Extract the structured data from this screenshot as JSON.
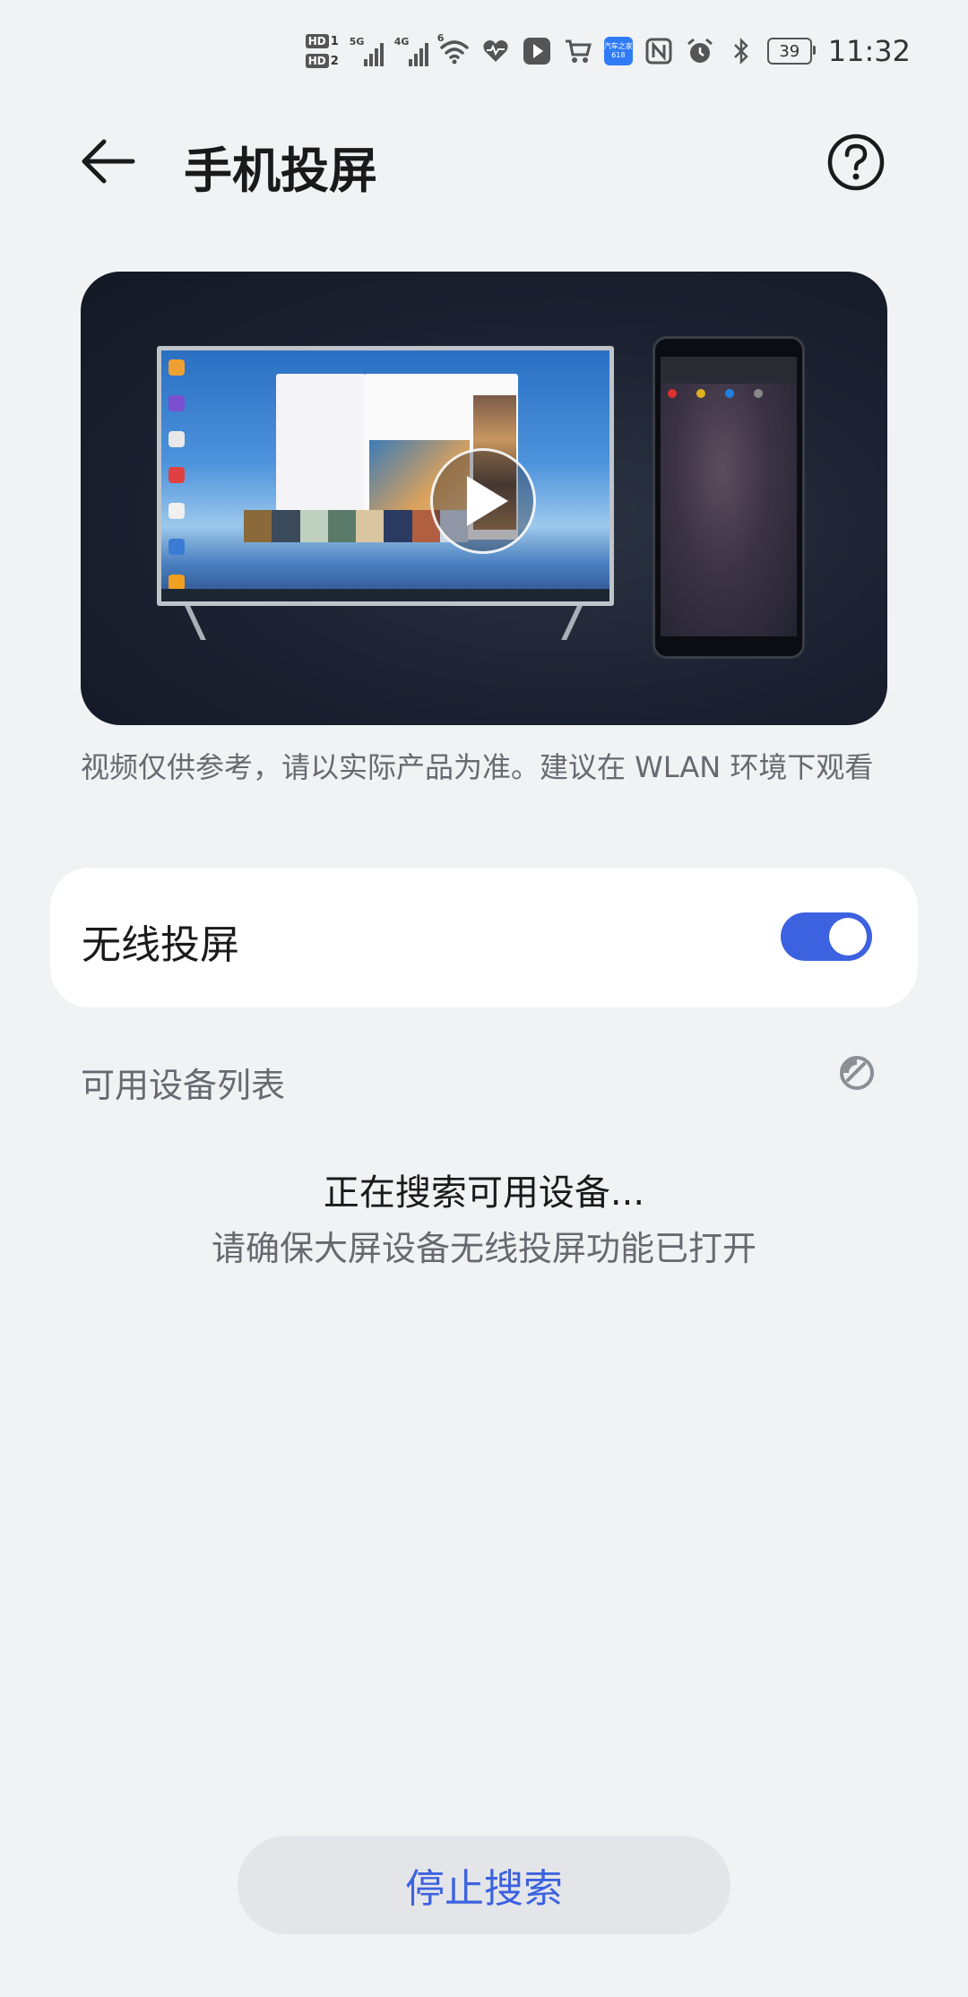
{
  "status_bar": {
    "hd1": "HD",
    "hd1_num": "1",
    "hd2": "HD",
    "hd2_num": "2",
    "net1": "5G",
    "net2": "4G",
    "wifi_num": "6",
    "app_badge": "汽车之家 618",
    "battery": "39",
    "time": "11:32"
  },
  "header": {
    "title": "手机投屏"
  },
  "video": {
    "note": "视频仅供参考，请以实际产品为准。建议在 WLAN 环境下观看"
  },
  "wireless": {
    "label": "无线投屏",
    "enabled": true,
    "accent": "#3c62e0"
  },
  "devices": {
    "label": "可用设备列表",
    "searching": "正在搜索可用设备...",
    "hint": "请确保大屏设备无线投屏功能已打开"
  },
  "actions": {
    "stop_label": "停止搜索"
  }
}
